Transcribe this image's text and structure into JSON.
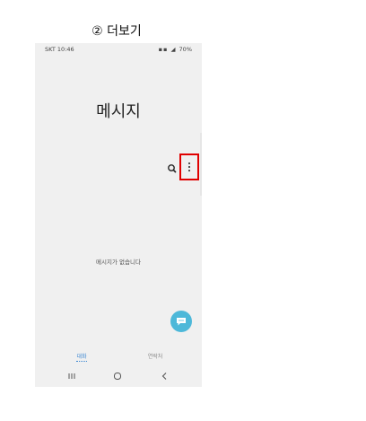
{
  "caption": "② 더보기",
  "status_bar": {
    "left": "SKT 10:46",
    "right": "70%"
  },
  "app": {
    "title": "메시지",
    "empty_message": "메시지가 없습니다"
  },
  "tabs": [
    {
      "label": "대화",
      "active": true
    },
    {
      "label": "연락처",
      "active": false
    }
  ],
  "icons": {
    "search": "search-icon",
    "more": "more-vertical-icon",
    "compose": "chat-bubble-icon",
    "recent_apps": "recent-apps-icon",
    "home": "home-icon",
    "back": "back-icon"
  },
  "colors": {
    "accent": "#4db8d9",
    "highlight": "#e00000",
    "tab_active": "#3a86d1"
  }
}
